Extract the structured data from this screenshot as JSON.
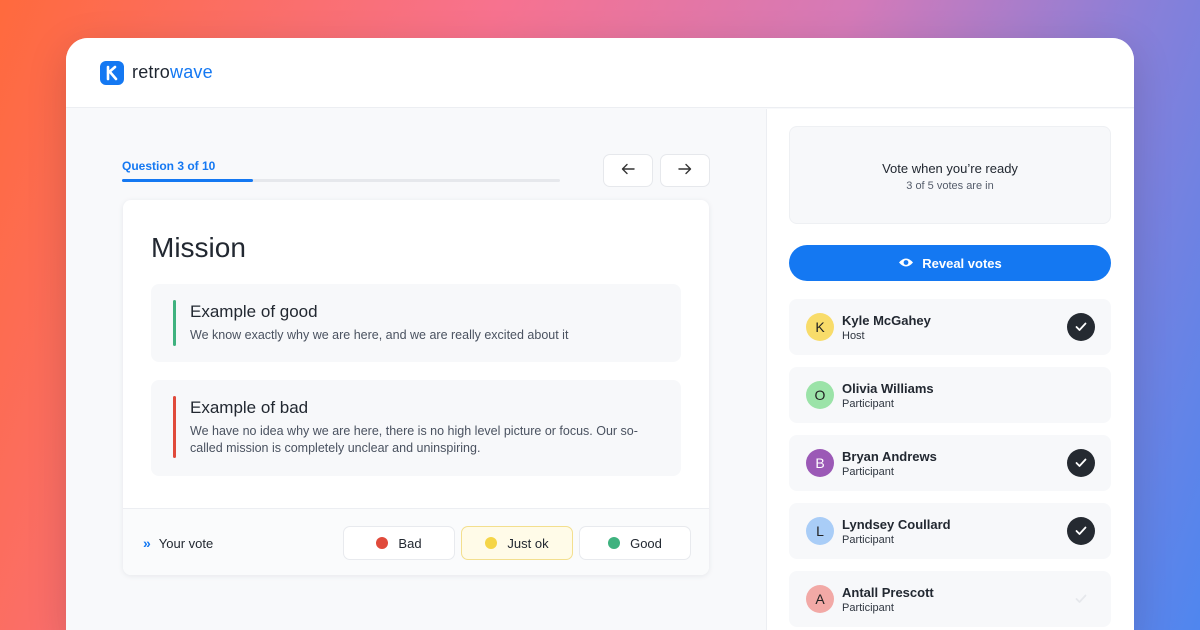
{
  "brand": {
    "name_part1": "retro",
    "name_part2": "wave",
    "accent": "#1478f2"
  },
  "progress": {
    "label": "Question 3 of 10",
    "current": 3,
    "total": 10
  },
  "navigation": {
    "prev_icon": "arrow-left-icon",
    "next_icon": "arrow-right-icon"
  },
  "question": {
    "title": "Mission",
    "good": {
      "title": "Example of good",
      "body": "We know exactly why we are here, and we are really excited about it",
      "color": "#3fb27f"
    },
    "bad": {
      "title": "Example of bad",
      "body": "We have no idea why we are here, there is no high level picture or focus. Our so-called mission is completely unclear and uninspiring.",
      "color": "#e04a3b"
    }
  },
  "vote": {
    "label": "Your vote",
    "options": [
      {
        "label": "Bad",
        "color": "#e04a3b",
        "selected": false
      },
      {
        "label": "Just ok",
        "color": "#f5d547",
        "selected": true
      },
      {
        "label": "Good",
        "color": "#3fb27f",
        "selected": false
      }
    ]
  },
  "status": {
    "title": "Vote when you’re ready",
    "subtitle": "3 of 5 votes are in"
  },
  "reveal": {
    "label": "Reveal votes",
    "icon": "eye-icon"
  },
  "participants": [
    {
      "initial": "K",
      "name": "Kyle McGahey",
      "role": "Host",
      "voted": true,
      "avatar_color": "#f8dc6a"
    },
    {
      "initial": "O",
      "name": "Olivia Williams",
      "role": "Participant",
      "voted": false,
      "avatar_color": "#9be3a8"
    },
    {
      "initial": "B",
      "name": "Bryan Andrews",
      "role": "Participant",
      "voted": true,
      "avatar_color": "#9b59b6"
    },
    {
      "initial": "L",
      "name": "Lyndsey Coullard",
      "role": "Participant",
      "voted": true,
      "avatar_color": "#a9cdf7"
    },
    {
      "initial": "A",
      "name": "Antall Prescott",
      "role": "Participant",
      "voted": false,
      "avatar_color": "#f2a9a6"
    }
  ]
}
